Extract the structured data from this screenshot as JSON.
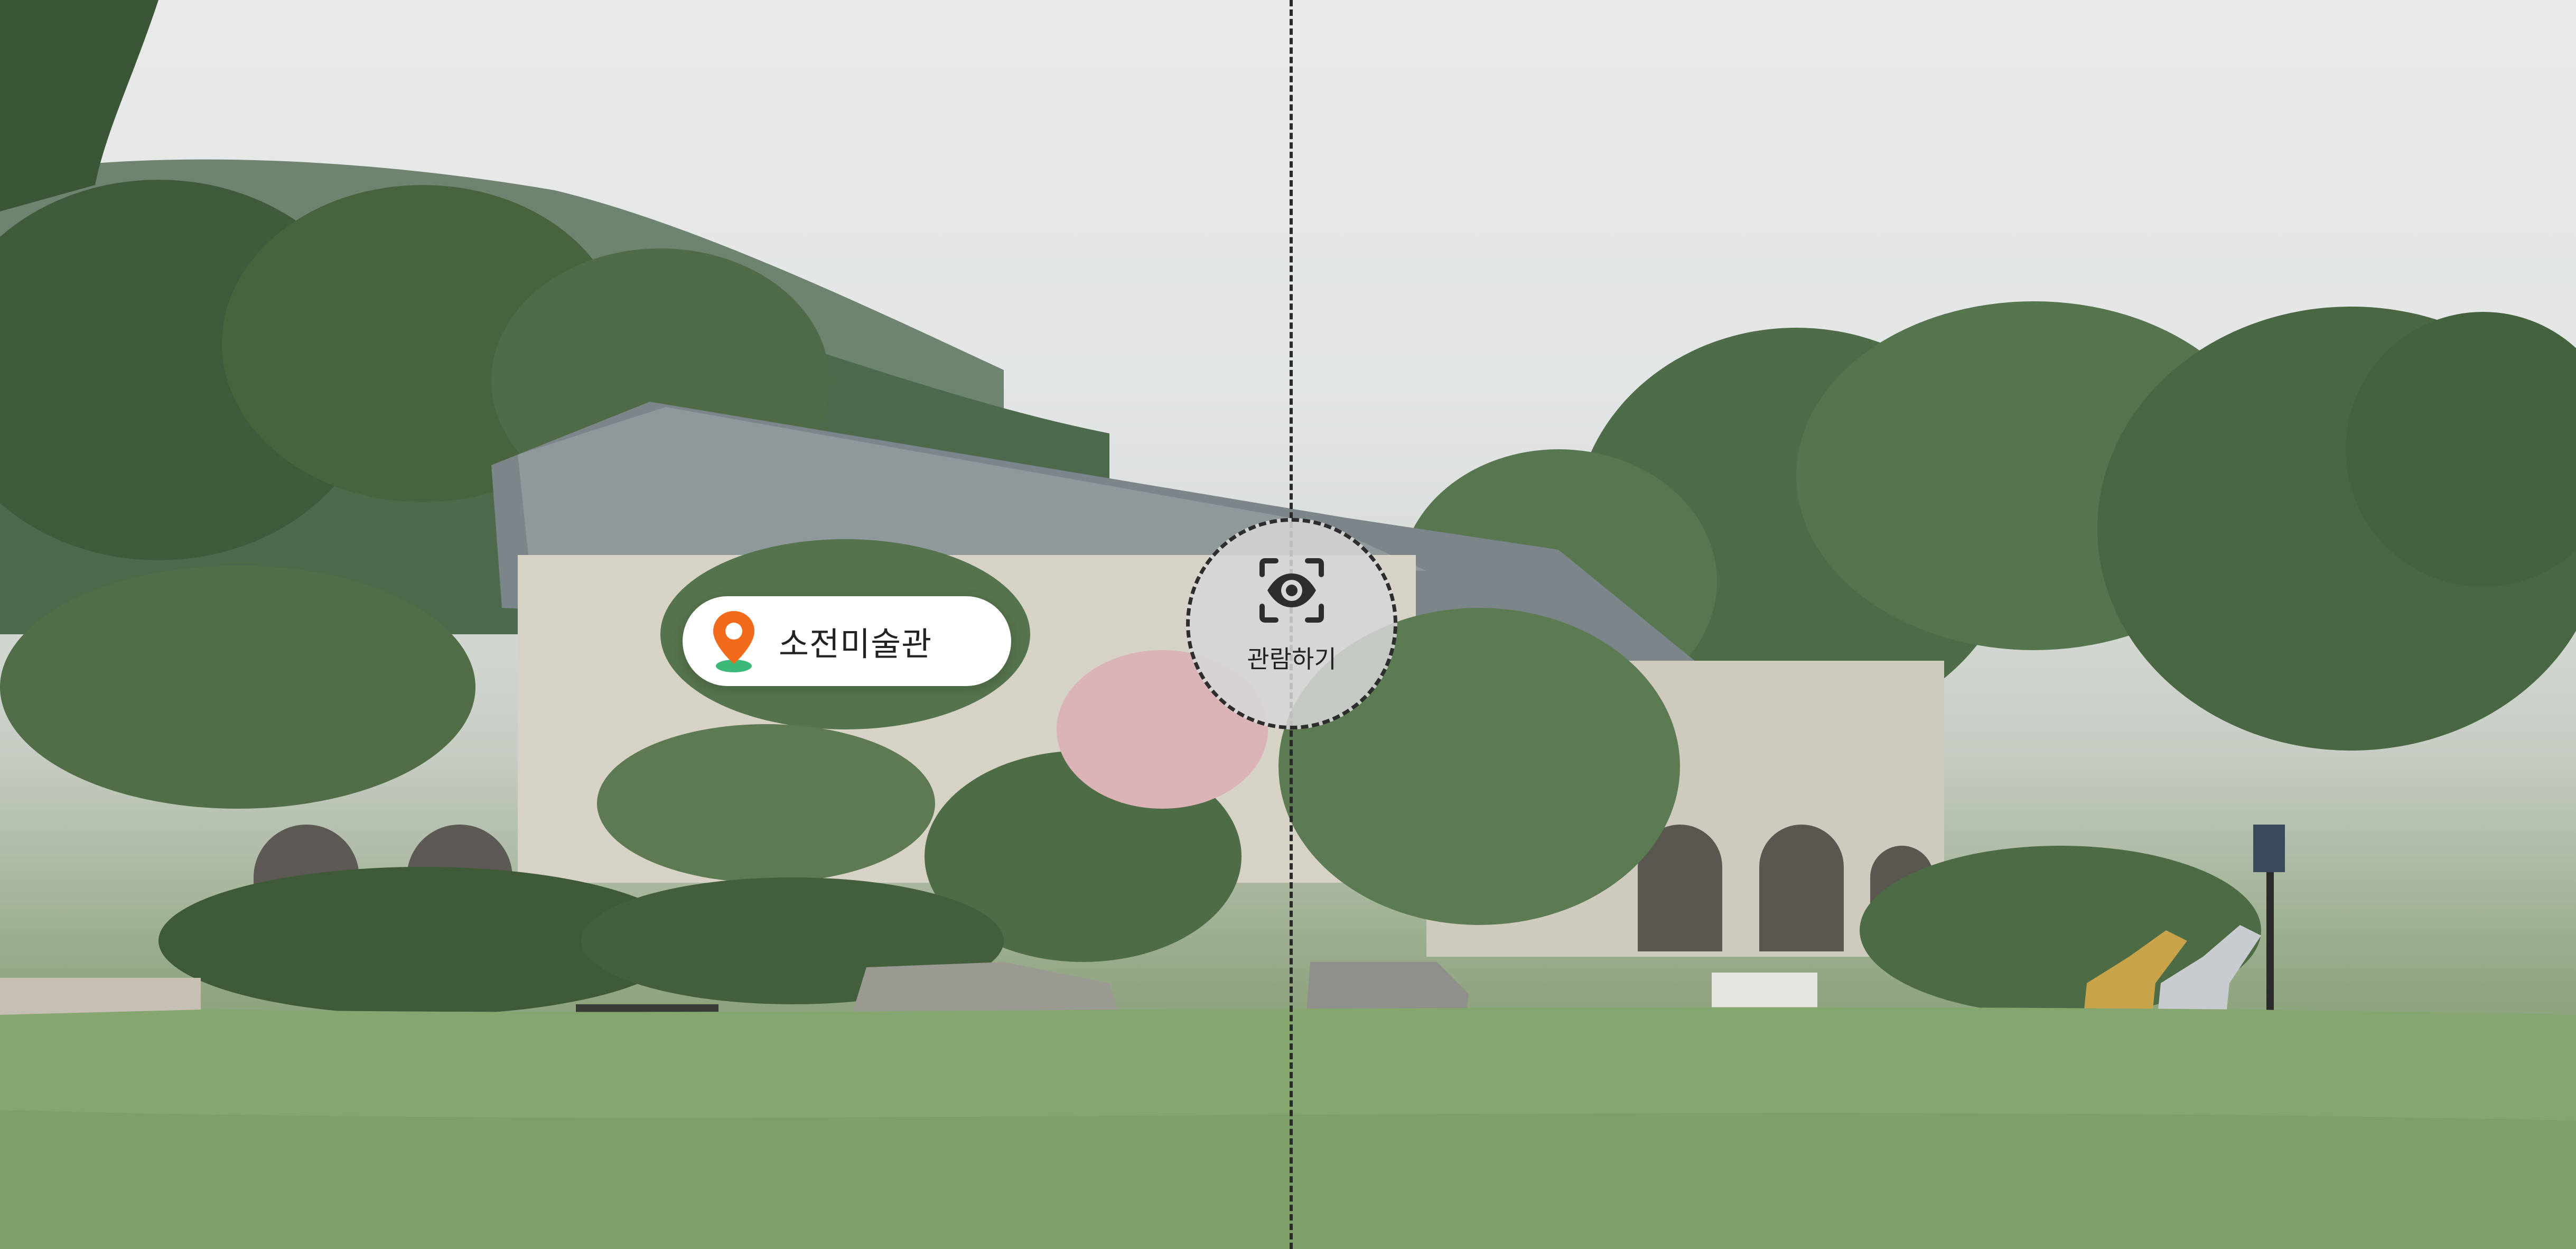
{
  "location": {
    "name": "소전미술관",
    "pin_icon": "map-pin-icon",
    "pin_color": "#f26b1d",
    "pin_base_color": "#3cb878"
  },
  "view_button": {
    "label": "관람하기",
    "icon": "eye-scan-icon"
  }
}
